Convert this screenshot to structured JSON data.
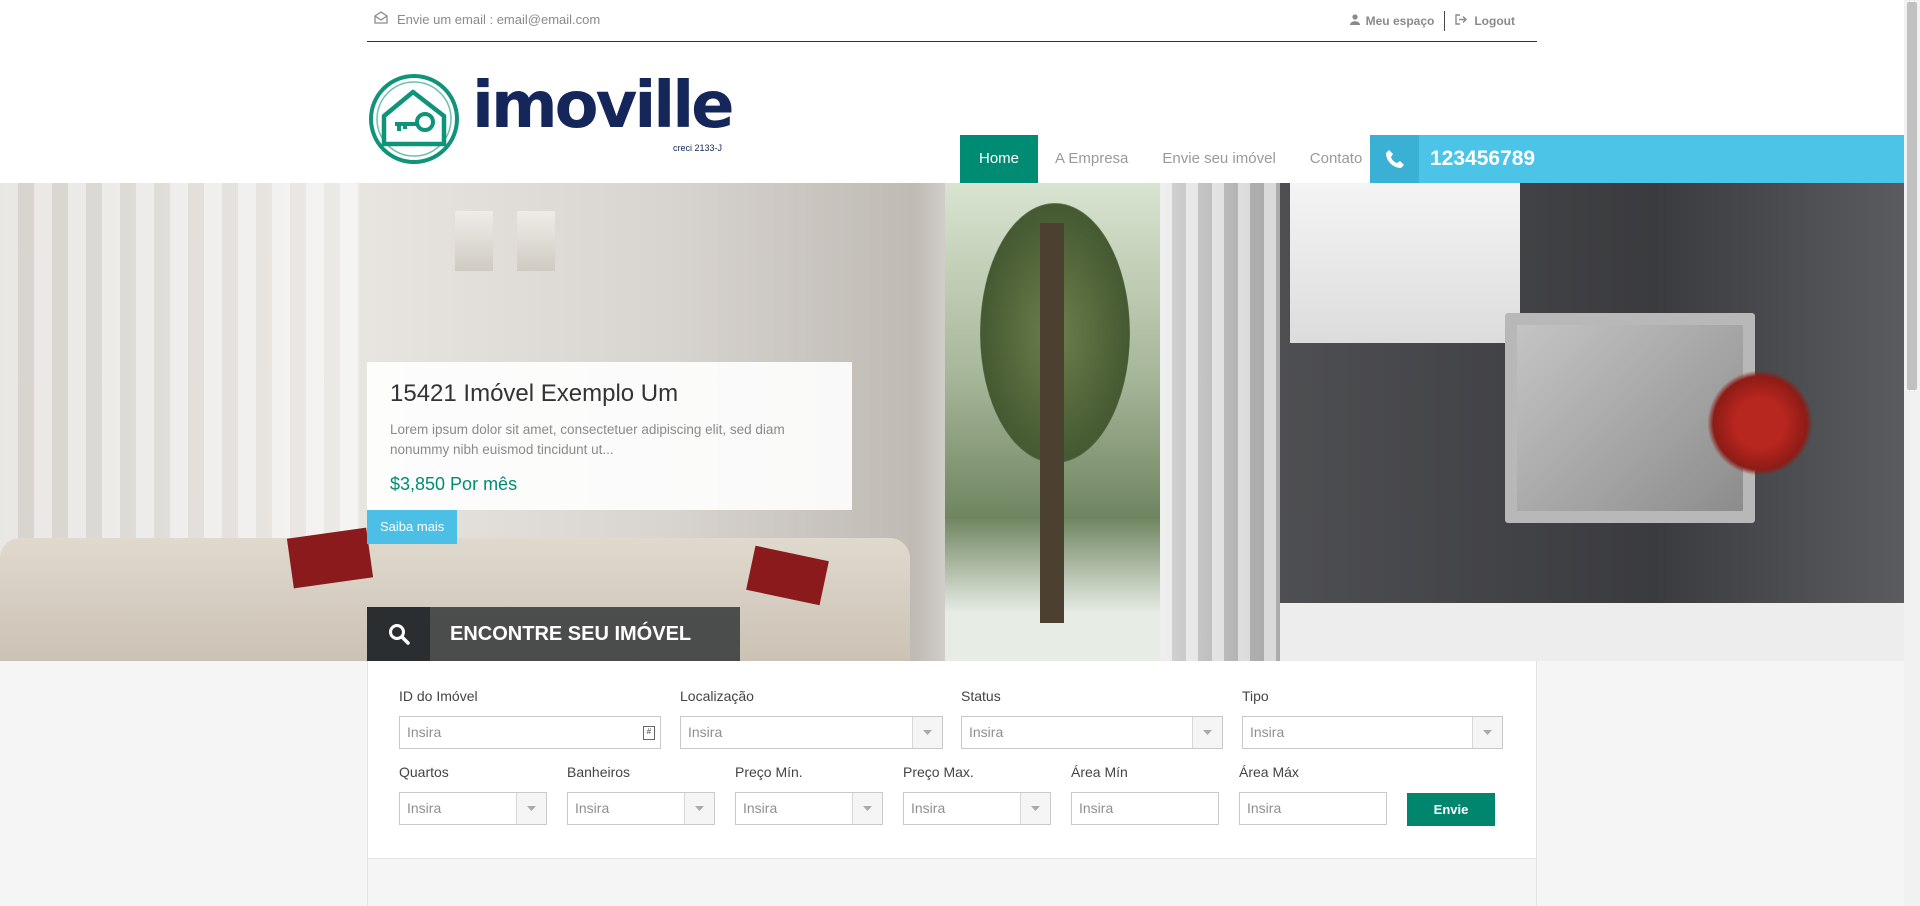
{
  "topbar": {
    "email_text": "Envie um email : email@email.com",
    "my_space": "Meu espaço",
    "logout": "Logout"
  },
  "logo": {
    "wordmark": "imoville",
    "creci": "creci 2133-J"
  },
  "nav": {
    "items": [
      "Home",
      "A Empresa",
      "Envie seu imóvel",
      "Contato"
    ],
    "active": "Home",
    "phone": "123456789"
  },
  "hero": {
    "title": "15421 Imóvel Exemplo Um",
    "description": "Lorem ipsum dolor sit amet, consectetuer adipiscing elit, sed diam nonummy nibh euismod tincidunt ut...",
    "price": "$3,850 Por mês",
    "cta": "Saiba mais",
    "find_label": "ENCONTRE SEU IMÓVEL"
  },
  "search": {
    "row1": [
      {
        "label": "ID do Imóvel",
        "placeholder": "Insira"
      },
      {
        "label": "Localização",
        "placeholder": "Insira"
      },
      {
        "label": "Status",
        "placeholder": "Insira"
      },
      {
        "label": "Tipo",
        "placeholder": "Insira"
      }
    ],
    "row2": [
      {
        "label": "Quartos",
        "placeholder": "Insira"
      },
      {
        "label": "Banheiros",
        "placeholder": "Insira"
      },
      {
        "label": "Preço Mín.",
        "placeholder": "Insira"
      },
      {
        "label": "Preço Max.",
        "placeholder": "Insira"
      },
      {
        "label": "Área Mín",
        "placeholder": "Insira"
      },
      {
        "label": "Área Máx",
        "placeholder": "Insira"
      }
    ],
    "submit": "Envie"
  },
  "colors": {
    "brand_green": "#008c74",
    "brand_blue": "#4bc4e7",
    "logo_navy": "#14265a"
  },
  "icons": {
    "email": "envelope-icon",
    "user": "user-icon",
    "logout": "logout-icon",
    "phone": "phone-icon",
    "search": "search-icon",
    "dropdown": "chevron-down-icon"
  }
}
